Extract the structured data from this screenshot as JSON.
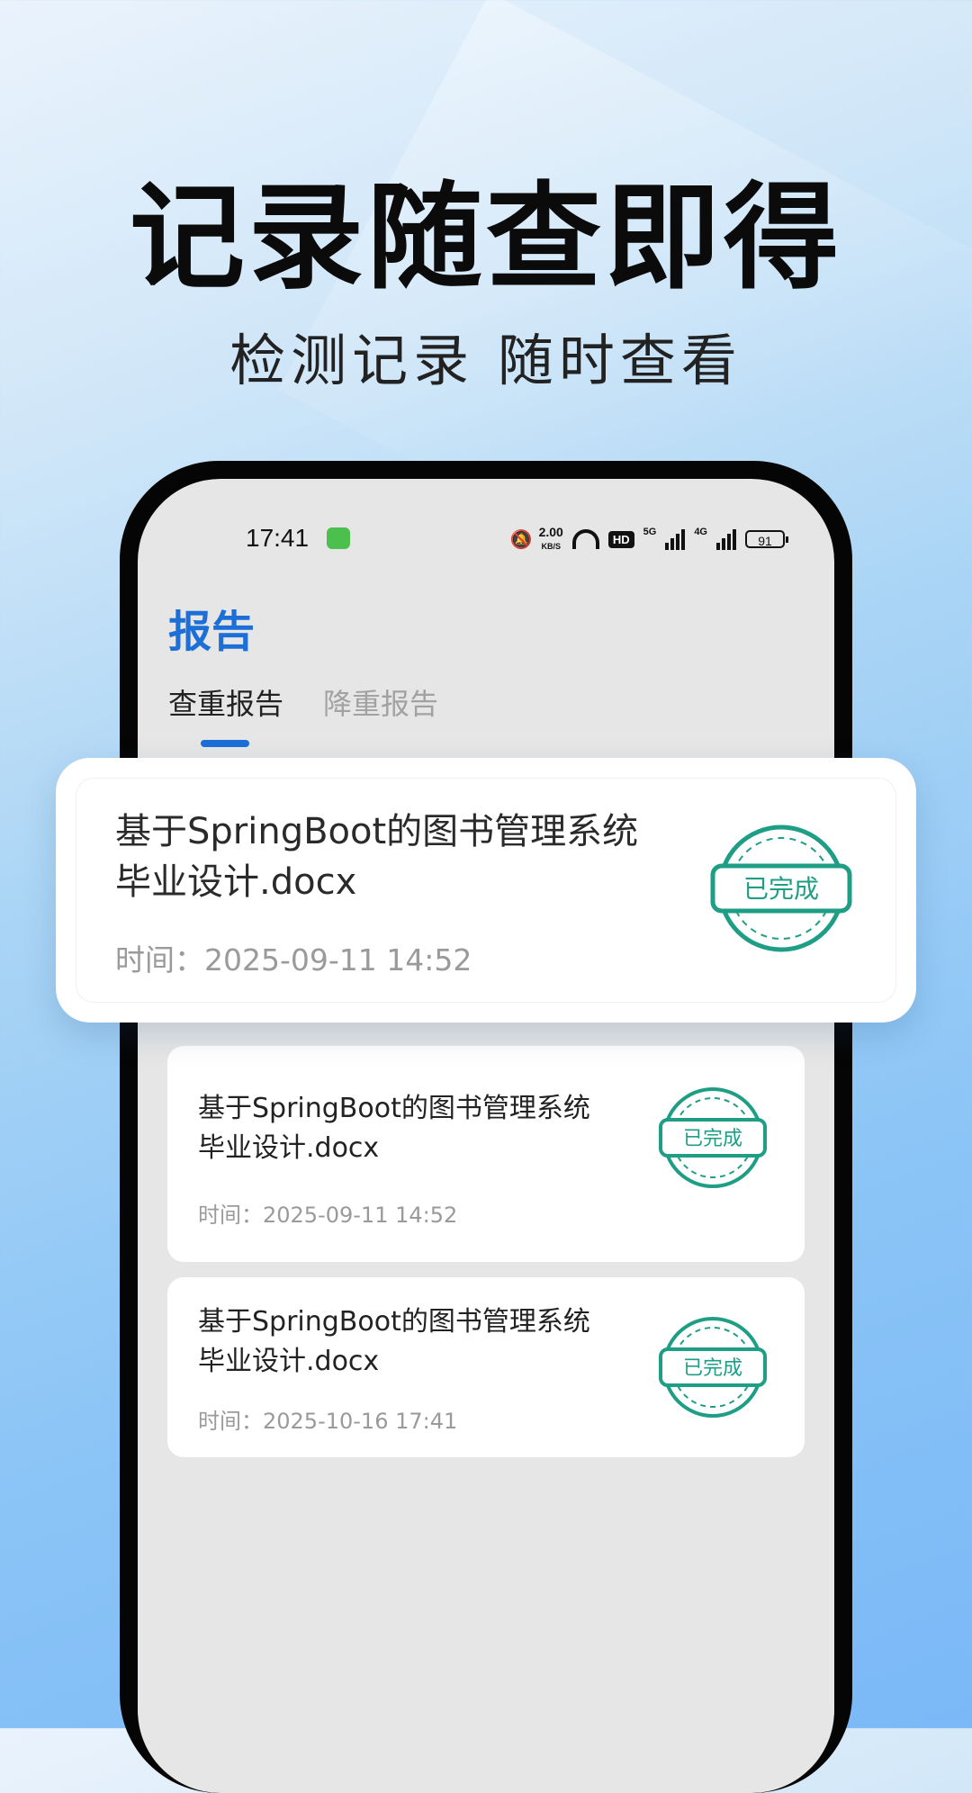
{
  "promo": {
    "headline": "记录随查即得",
    "subheadline": "检测记录 随时查看"
  },
  "statusbar": {
    "time": "17:41",
    "net_speed": "2.00",
    "net_unit": "KB/S",
    "hd_label": "HD",
    "signal1_label": "5G",
    "signal2_label": "4G",
    "battery": "91"
  },
  "page": {
    "title": "报告",
    "tabs": [
      {
        "label": "查重报告",
        "active": true
      },
      {
        "label": "降重报告",
        "active": false
      }
    ]
  },
  "highlight_card": {
    "title_line1": "基于SpringBoot的图书管理系统",
    "title_line2": "毕业设计.docx",
    "time": "时间：2025-09-11 14:52",
    "status": "已完成"
  },
  "reports": [
    {
      "title_line1": "基于SpringBoot的图书管理系统",
      "title_line2": "毕业设计.docx",
      "time": "时间：2025-09-11 14:52",
      "status": "已完成"
    },
    {
      "title_line1": "基于SpringBoot的图书管理系统",
      "title_line2": "毕业设计.docx",
      "time": "时间：2025-10-16 17:41",
      "status": "已完成"
    }
  ],
  "colors": {
    "accent": "#1c6fd7",
    "stamp": "#1f9e86"
  }
}
